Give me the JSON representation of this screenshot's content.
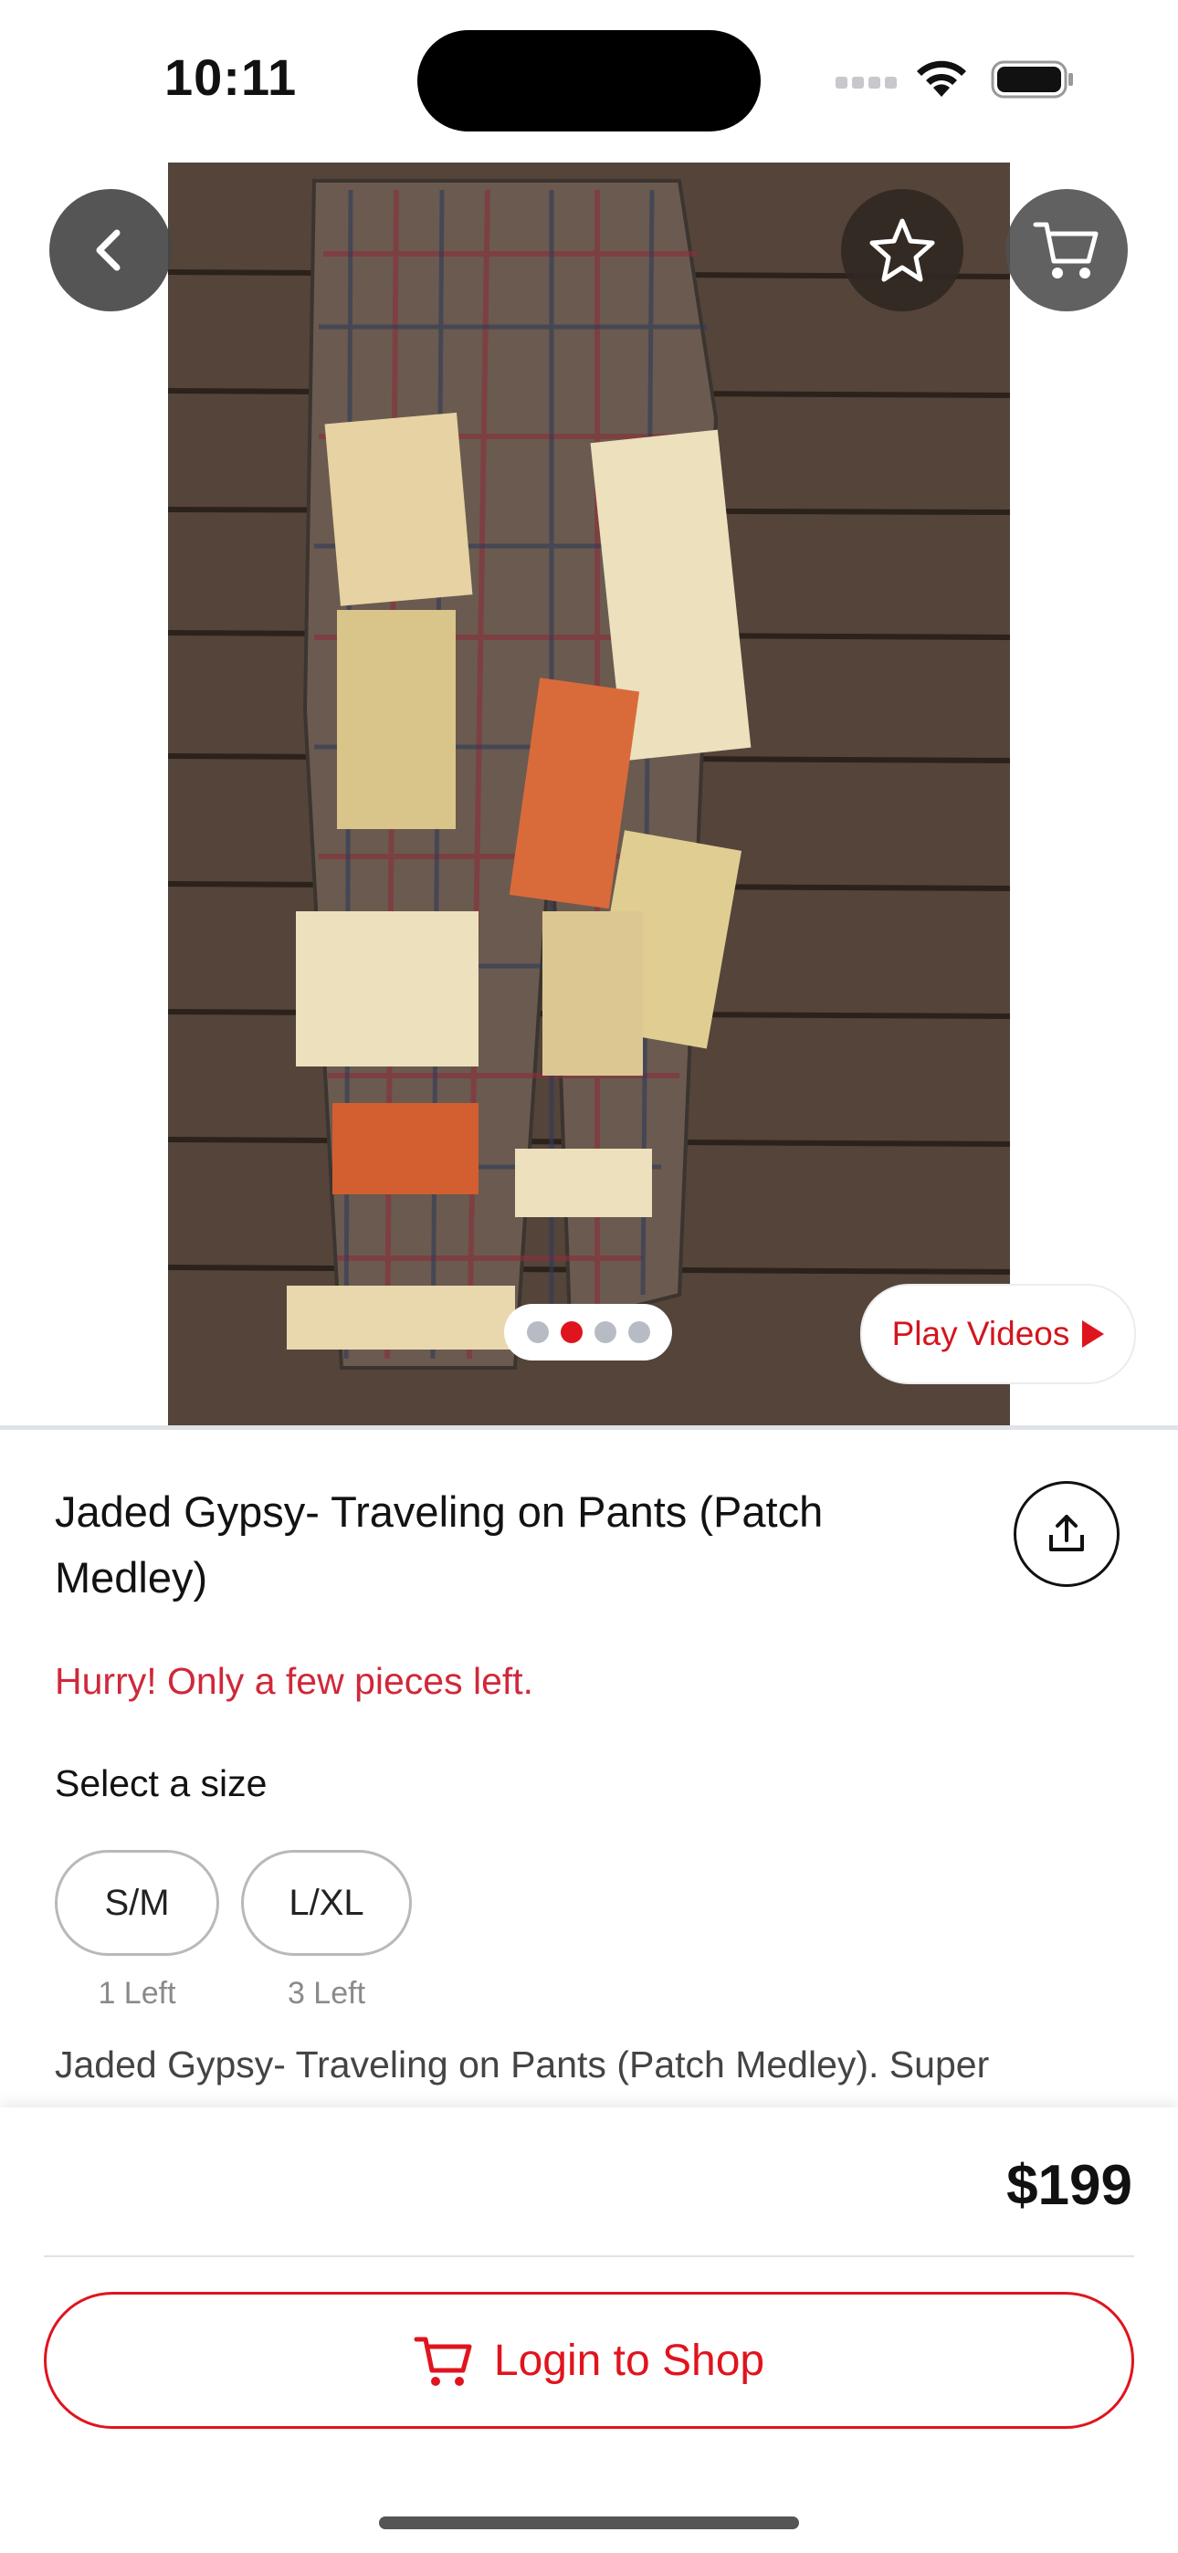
{
  "status_bar": {
    "time": "10:11"
  },
  "hero": {
    "pager": {
      "count": 4,
      "active_index": 1
    },
    "play_videos_label": "Play Videos"
  },
  "product": {
    "title": "Jaded Gypsy- Traveling on Pants (Patch Medley)",
    "stock_warning": "Hurry! Only a few pieces left.",
    "size_heading": "Select a size",
    "sizes": [
      {
        "label": "S/M",
        "stock": "1 Left"
      },
      {
        "label": "L/XL",
        "stock": "3 Left"
      }
    ],
    "description": "Jaded Gypsy- Traveling on Pants (Patch Medley). Super"
  },
  "purchase": {
    "price": "$199",
    "login_label": "Login to Shop"
  },
  "colors": {
    "accent": "#e0141e",
    "warning_text": "#d0283a"
  }
}
